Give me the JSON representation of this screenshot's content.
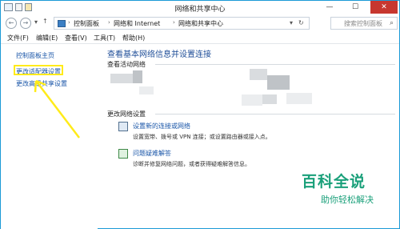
{
  "window": {
    "title": "网络和共享中心",
    "minimize": "—",
    "maximize": "☐",
    "close": "✕"
  },
  "nav": {
    "back": "←",
    "forward": "→",
    "up": "↑",
    "breadcrumbs": [
      "控制面板",
      "网络和 Internet",
      "网络和共享中心"
    ],
    "dropdown": "▾",
    "refresh": "↻",
    "search_placeholder": "搜索控制面板"
  },
  "menu": [
    "文件(F)",
    "编辑(E)",
    "查看(V)",
    "工具(T)",
    "帮助(H)"
  ],
  "left_pane": {
    "items": [
      "控制面板主页",
      "更改适配器设置",
      "更改高级共享设置"
    ]
  },
  "main": {
    "heading": "查看基本网络信息并设置连接",
    "active_networks_title": "查看活动网络",
    "change_settings_title": "更改网络设置",
    "tasks": [
      {
        "link": "设置新的连接或网络",
        "description": "设置宽带、拨号或 VPN 连接；或设置路由器或接入点。",
        "icon": "network-setup-icon"
      },
      {
        "link": "问题疑难解答",
        "description": "诊断并修复网络问题，或者获得疑难解答信息。",
        "icon": "troubleshoot-icon"
      }
    ]
  },
  "watermark": {
    "main": "百科全说",
    "sub": "助你轻松解决"
  },
  "colors": {
    "link": "#1a56a8",
    "heading": "#1f4e98",
    "highlight": "#ffeb1a",
    "watermark": "#1aa07a",
    "close": "#c7372f"
  }
}
